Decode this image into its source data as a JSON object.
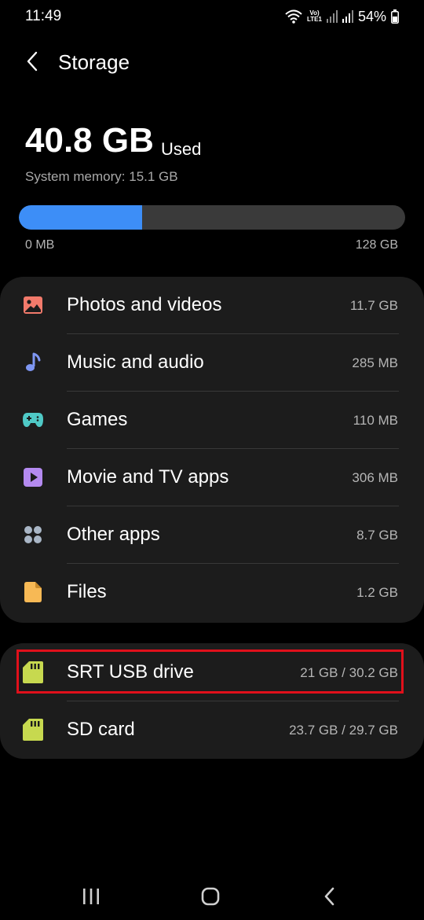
{
  "status_bar": {
    "time": "11:49",
    "battery": "54%",
    "volte_top": "Vo)",
    "volte_bottom": "LTE1"
  },
  "header": {
    "title": "Storage"
  },
  "summary": {
    "used_amount": "40.8 GB",
    "used_label": "Used",
    "system_memory": "System memory: 15.1 GB",
    "used_fraction": 0.3188,
    "bar_min": "0 MB",
    "bar_max": "128 GB"
  },
  "categories": [
    {
      "label": "Photos and videos",
      "value": "11.7 GB",
      "icon": "image-icon",
      "color": "#f27a6b"
    },
    {
      "label": "Music and audio",
      "value": "285 MB",
      "icon": "music-note-icon",
      "color": "#7e96f2"
    },
    {
      "label": "Games",
      "value": "110 MB",
      "icon": "gamepad-icon",
      "color": "#4fc9c6"
    },
    {
      "label": "Movie and TV apps",
      "value": "306 MB",
      "icon": "play-icon",
      "color": "#b48af0"
    },
    {
      "label": "Other apps",
      "value": "8.7 GB",
      "icon": "apps-grid-icon",
      "color": "#a9b6c6"
    },
    {
      "label": "Files",
      "value": "1.2 GB",
      "icon": "file-icon",
      "color": "#f7b955"
    }
  ],
  "drives": [
    {
      "label": "SRT USB drive",
      "value": "21 GB / 30.2 GB",
      "icon": "sd-card-icon",
      "color": "#c7d94f"
    },
    {
      "label": "SD card",
      "value": "23.7 GB / 29.7 GB",
      "icon": "sd-card-icon",
      "color": "#c7d94f"
    }
  ],
  "colors": {
    "background": "#000000",
    "card": "#1c1c1c",
    "accent": "#3d8ef7",
    "highlight": "#e0101b"
  },
  "nav": {
    "icons": [
      "recents-icon",
      "home-icon",
      "back-icon"
    ]
  }
}
